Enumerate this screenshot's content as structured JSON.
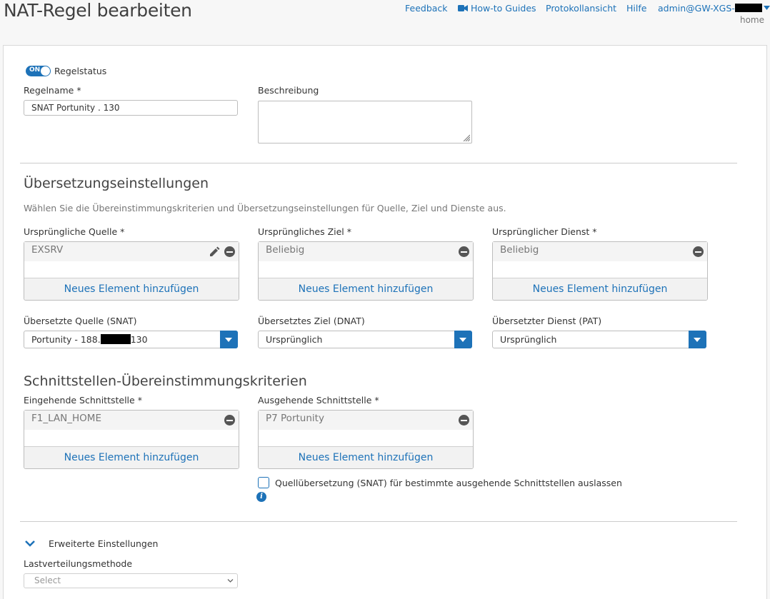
{
  "header": {
    "title": "NAT-Regel bearbeiten",
    "nav": {
      "feedback": "Feedback",
      "howto": "How-to Guides",
      "log": "Protokollansicht",
      "help": "Hilfe",
      "user": "admin@GW-XGS-",
      "home": "home"
    }
  },
  "rule": {
    "status_label": "Regelstatus",
    "status_toggle": "ON",
    "name_label": "Regelname *",
    "name_value": "SNAT Portunity . 130",
    "desc_label": "Beschreibung"
  },
  "translation": {
    "title": "Übersetzungseinstellungen",
    "hint": "Wählen Sie die Übereinstimmungskriterien und Übersetzungseinstellungen für Quelle, Ziel und Dienste aus.",
    "orig_source_label": "Ursprüngliche Quelle *",
    "orig_source_item": "EXSRV",
    "orig_dest_label": "Ursprüngliches Ziel *",
    "orig_dest_item": "Beliebig",
    "orig_service_label": "Ursprünglicher Dienst *",
    "orig_service_item": "Beliebig",
    "add_new": "Neues Element hinzufügen",
    "snat_label": "Übersetzte Quelle (SNAT)",
    "snat_value_prefix": "Portunity - 188.",
    "snat_value_suffix": "130",
    "dnat_label": "Übersetztes Ziel (DNAT)",
    "dnat_value": "Ursprünglich",
    "pat_label": "Übersetzter Dienst (PAT)",
    "pat_value": "Ursprünglich"
  },
  "interfaces": {
    "title": "Schnittstellen-Übereinstimmungskriterien",
    "inbound_label": "Eingehende Schnittstelle *",
    "inbound_item": "F1_LAN_HOME",
    "outbound_label": "Ausgehende Schnittstelle *",
    "outbound_item": "P7 Portunity",
    "skip_snat_label": "Quellübersetzung (SNAT) für bestimmte ausgehende Schnittstellen auslassen",
    "info_glyph": "i"
  },
  "advanced": {
    "title": "Erweiterte Einstellungen",
    "lb_label": "Lastverteilungsmethode",
    "lb_placeholder": "Select"
  },
  "colors": {
    "accent": "#1d72b8"
  }
}
